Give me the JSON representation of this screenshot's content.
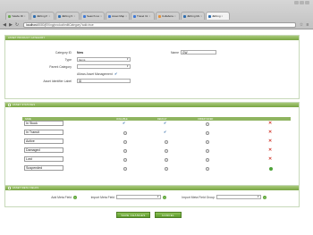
{
  "browser": {
    "tabs": [
      {
        "label": "Yelabs ID",
        "color": "#6aa84f"
      },
      {
        "label": "JEKing P",
        "color": "#2b6cb0"
      },
      {
        "label": "JEKing S",
        "color": "#2b6cb0"
      },
      {
        "label": "Search res",
        "color": "#3c78d8"
      },
      {
        "label": "Asset Map",
        "color": "#3c78d8"
      },
      {
        "label": "Travel Inf",
        "color": "#3c78d8"
      },
      {
        "label": "Collabora",
        "color": "#e69138"
      },
      {
        "label": "JEKing Ma",
        "color": "#2b6cb0"
      },
      {
        "label": "JEKing",
        "color": "#2b6cb0"
      }
    ],
    "url_host": "localhost",
    "url_path": ":8080/jEKing/product/editCategory?add=true"
  },
  "general": {
    "header": "ASSET PRODUCT CATEGORY",
    "category_id_label": "Category ID",
    "category_id_value": "New",
    "name_label": "Name",
    "name_value": "GW",
    "type_label": "Type",
    "type_value": "Items",
    "parent_label": "Parent Category",
    "parent_value": "",
    "allows_asset_label": "Allows Asset Management",
    "asset_identifier_label": "Asset Identifier Label",
    "asset_identifier_value": "ID"
  },
  "statuses": {
    "header": "ASSET STATUSES",
    "col_name": "NAME",
    "col_available": "AVAILABLE",
    "col_default": "DEFAULT",
    "col_order_saved": "ORDER SAVED",
    "rows": [
      {
        "name": "In Stock"
      },
      {
        "name": "In Transit"
      },
      {
        "name": "Active"
      },
      {
        "name": "Damaged"
      },
      {
        "name": "Lost"
      },
      {
        "name": "Suspended"
      }
    ]
  },
  "meta": {
    "header": "ASSET META FIELDS",
    "add_label": "Add Meta Field",
    "import_label": "Import Meta Field",
    "import_group_label": "Import Meta Field Group"
  },
  "actions": {
    "save_label": "SAVE CHANGES",
    "cancel_label": "CANCEL"
  }
}
